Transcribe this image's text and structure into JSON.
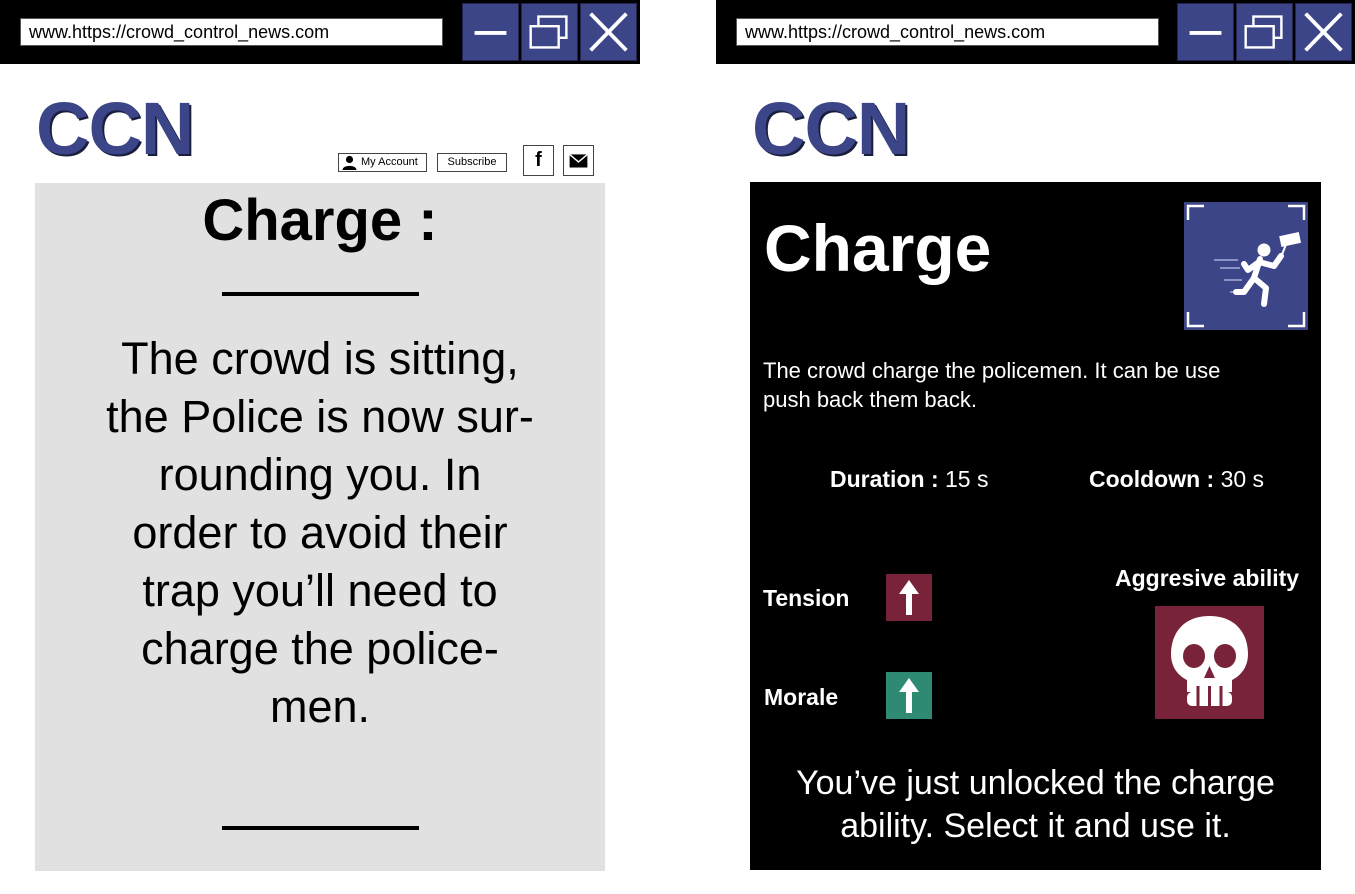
{
  "windows": [
    {
      "url": "www.https://crowd_control_news.com"
    },
    {
      "url": "www.https://crowd_control_news.com"
    }
  ],
  "window_controls": [
    "minimize-icon",
    "restore-icon",
    "close-icon"
  ],
  "brand": {
    "logo_text": "CCN",
    "color": "#3c4587"
  },
  "toolbar": {
    "account_label": "My Account",
    "subscribe_label": "Subscribe",
    "facebook_label": "f"
  },
  "left_panel": {
    "title": "Charge :",
    "body_lines": [
      "The crowd is sitting,",
      "the Police is now sur-",
      "rounding you. In",
      "order to avoid their",
      "trap you’ll need to",
      "charge the police-",
      "men."
    ],
    "background": "#e1e1e1"
  },
  "right_panel": {
    "title": "Charge",
    "icon": "running-protester-icon",
    "description_lines": [
      "The crowd charge the policemen. It can be use",
      "push back them back."
    ],
    "duration_label": "Duration :",
    "duration_value": "15 s",
    "cooldown_label": "Cooldown :",
    "cooldown_value": "30 s",
    "tension_label": "Tension",
    "tension_icon": "arrow-up-icon",
    "tension_color": "#782339",
    "morale_label": "Morale",
    "morale_icon": "arrow-up-icon",
    "morale_color": "#2e8a72",
    "ability_type_label": "Aggresive ability",
    "ability_icon": "skull-icon",
    "footer_lines": [
      "You’ve just unlocked the charge",
      "ability. Select it and use it."
    ]
  }
}
